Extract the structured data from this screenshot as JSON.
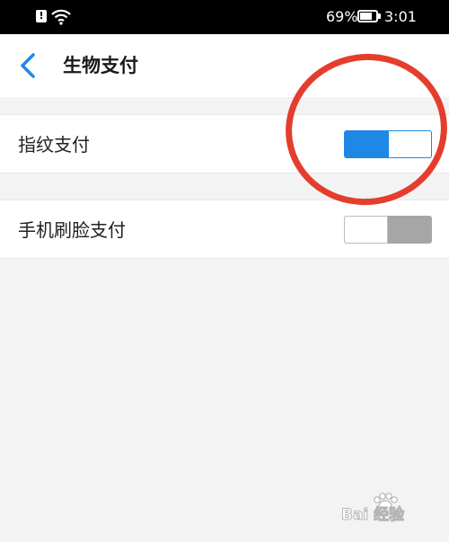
{
  "status_bar": {
    "alert_glyph": "!",
    "battery_percent": "69%",
    "time": "3:01"
  },
  "header": {
    "title": "生物支付"
  },
  "settings": [
    {
      "label": "指纹支付",
      "enabled": true
    },
    {
      "label": "手机刷脸支付",
      "enabled": false
    }
  ],
  "colors": {
    "accent": "#1e88e5",
    "toggle_off": "#a6a6a6",
    "annotation_circle": "#e53d2d"
  },
  "watermark": {
    "text": "Bai 经验"
  }
}
